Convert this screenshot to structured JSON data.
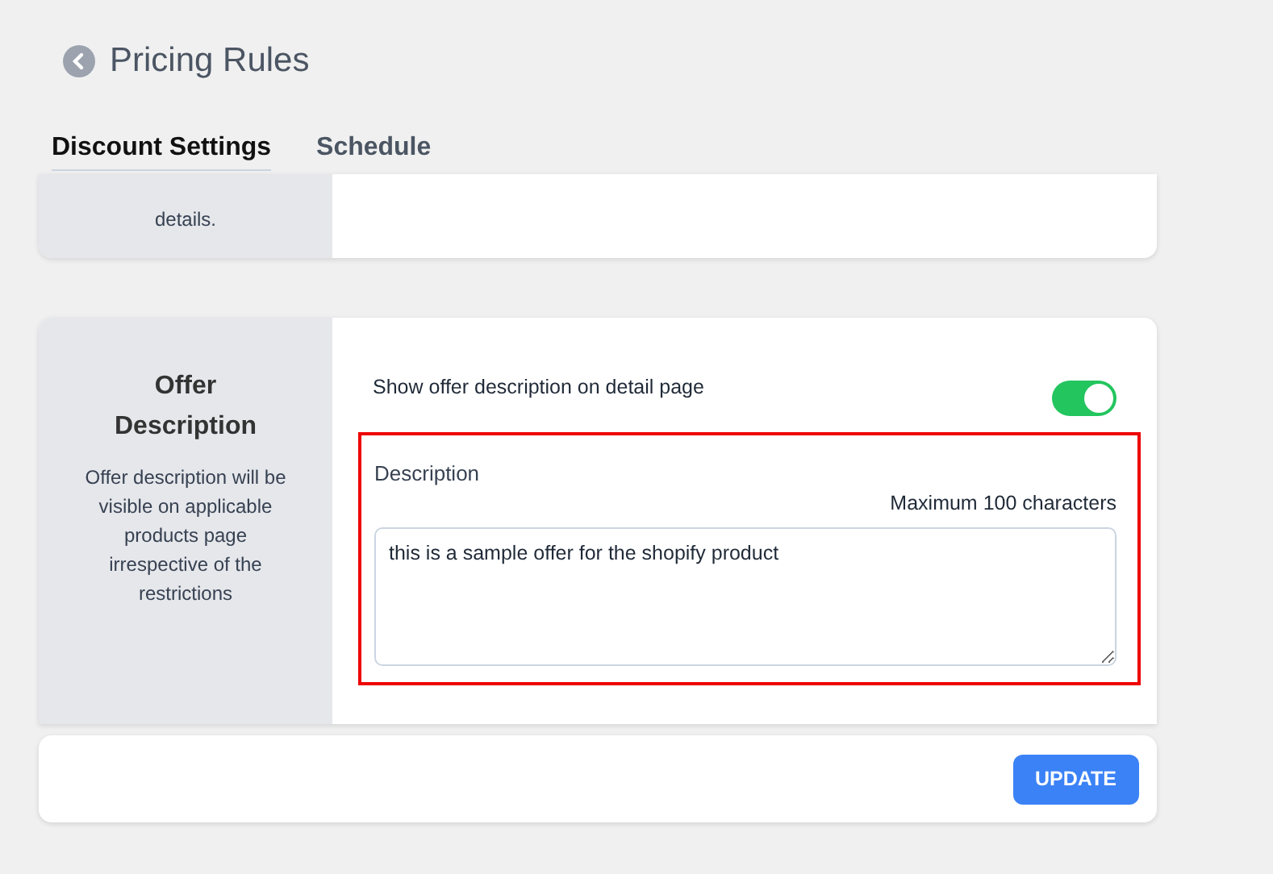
{
  "header": {
    "title": "Pricing Rules"
  },
  "tabs": [
    {
      "label": "Discount Settings",
      "selected": true
    },
    {
      "label": "Schedule",
      "selected": false
    }
  ],
  "previous_section": {
    "description": "details."
  },
  "offer_section": {
    "title": "Offer Description",
    "description": "Offer description will be visible on applicable products page irrespective of the restrictions",
    "toggle": {
      "label": "Show offer description on detail page",
      "on": true
    },
    "field": {
      "label": "Description",
      "hint": "Maximum 100 characters",
      "value": "this is a sample offer for the shopify product",
      "highlighted": true
    }
  },
  "buttons": [
    "UPDATE"
  ]
}
